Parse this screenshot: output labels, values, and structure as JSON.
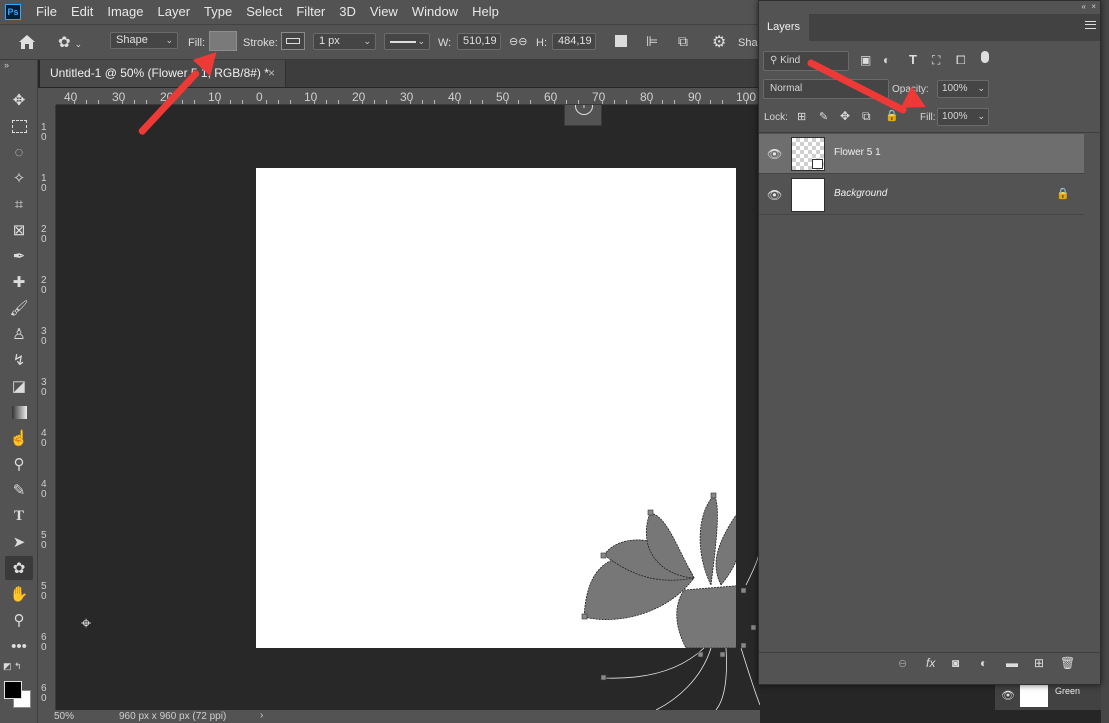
{
  "app": {
    "logo_text": "Ps"
  },
  "menu": [
    "File",
    "Edit",
    "Image",
    "Layer",
    "Type",
    "Select",
    "Filter",
    "3D",
    "View",
    "Window",
    "Help"
  ],
  "options": {
    "shape_mode": "Shape",
    "fill_label": "Fill:",
    "stroke_label": "Stroke:",
    "stroke_width": "1 px",
    "w_label": "W:",
    "w_value": "510,19 p",
    "h_label": "H:",
    "h_value": "484,19 p",
    "cut_label": "Sha"
  },
  "document": {
    "tab_title": "Untitled-1 @ 50% (Flower 5 1, RGB/8#) *",
    "close": "×"
  },
  "ruler": {
    "h_labels": [
      "40",
      "30",
      "20",
      "10",
      "0",
      "10",
      "20",
      "30",
      "40",
      "50",
      "60",
      "70",
      "80",
      "90",
      "100"
    ]
  },
  "status": {
    "zoom": "50%",
    "doc_info": "960 px x 960 px (72 ppi)"
  },
  "layers_panel": {
    "title": "Layers",
    "filter_kind": "Kind",
    "blend_mode": "Normal",
    "opacity_label": "Opacity:",
    "opacity_value": "100%",
    "lock_label": "Lock:",
    "fill_label": "Fill:",
    "fill_value": "100%",
    "layers": [
      {
        "name": "Flower 5 1",
        "selected": true
      },
      {
        "name": "Background",
        "locked": true
      }
    ],
    "behind_layer_name": "Green"
  },
  "colors": {
    "accent_arrow": "#ee3a37",
    "fill_swatch": "#7a7a7a",
    "shape_fill": "#777777"
  }
}
